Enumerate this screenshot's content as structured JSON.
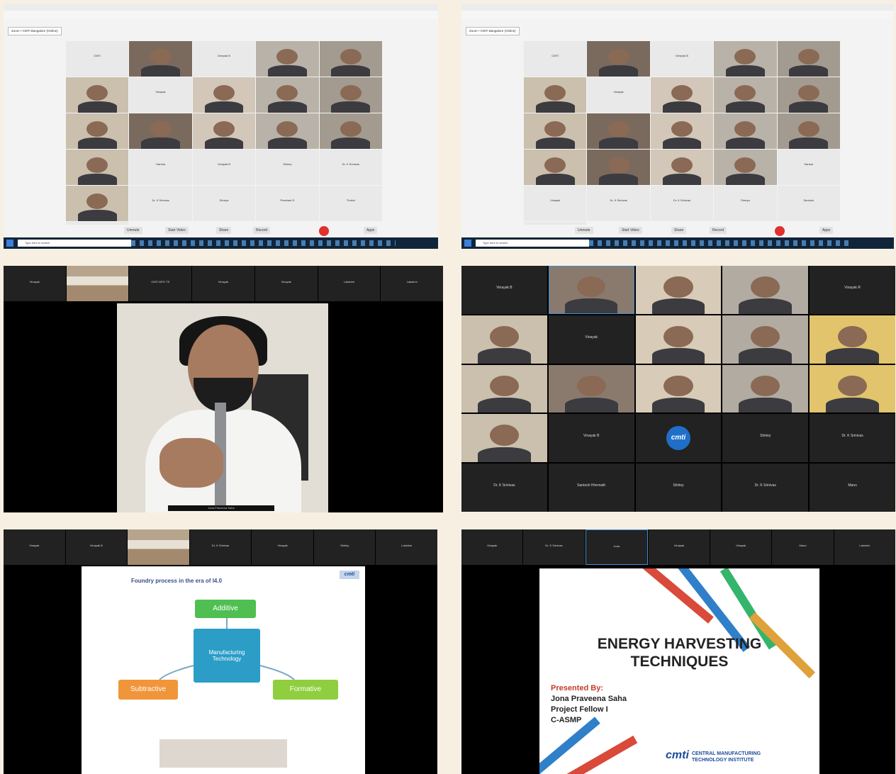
{
  "gallery1": {
    "url_text": "Zoom • CMTI Bangalore (Online)",
    "tiles": [
      "CMTI",
      "",
      "Deepak B",
      "",
      "",
      "",
      "Vinayak",
      "",
      "",
      "",
      "",
      "",
      "",
      "",
      "",
      "",
      "Harsha",
      "Vinayak B",
      "Shirley",
      "Dr. K Srinivas",
      "",
      "Dr. K Srinivas",
      "Shreya",
      "Prashant R",
      "Thrishi",
      "Lakshmi"
    ]
  },
  "gallery2": {
    "url_text": "Zoom • CMTI Bangalore (Online)",
    "tiles": [
      "CMTI",
      "",
      "Deepak B",
      "",
      "",
      "",
      "Vinayak",
      "",
      "",
      "",
      "",
      "",
      "",
      "",
      "",
      "",
      "",
      "",
      "",
      "Sankar",
      "Vinayak",
      "Dr. K Srinivas",
      "Dr. K Srinivas",
      "Shreya",
      "Santosh",
      "Manu"
    ]
  },
  "controls": {
    "unmute": "Unmute",
    "start_video": "Start Video",
    "share": "Share",
    "record": "Record",
    "apps": "Apps",
    "search": "Type here to search"
  },
  "strip3": [
    "Vinayak",
    "",
    "CMTI MFG TE",
    "Vinayak",
    "Vinayak",
    "Lakshmi",
    "Lakshmi"
  ],
  "presenter_caption": "Jona Praveena Saha",
  "grid4": [
    "Vinayak B",
    "",
    "",
    "",
    "Vinayak R",
    "",
    "Vinayak",
    "",
    "",
    "",
    "",
    "",
    "",
    "",
    "",
    "",
    "Vinayak B",
    "CMTI",
    "Shirley",
    "Dr. K Srinivas",
    "Dr. K Srinivas",
    "Santosh Hiremath",
    "Shirley",
    "Dr. K Srinivas",
    "Manu"
  ],
  "strip5": [
    "Vinayak",
    "Vinayak B",
    "",
    "Dr. K Srinivas",
    "Vinayak",
    "Shirley",
    "Lakshmi"
  ],
  "slide5": {
    "title": "Foundry process in the era of I4.0",
    "center": "Manufacturing Technology",
    "top": "Additive",
    "left": "Subtractive",
    "right": "Formative",
    "logo": "cmti"
  },
  "strip6": [
    "Vinayak",
    "Dr. K Srinivas",
    "Jona",
    "Vinayak",
    "Vinayak",
    "Manu",
    "Lakshmi"
  ],
  "slide6": {
    "title1": "ENERGY HARVESTING",
    "title2": "TECHNIQUES",
    "presented_by": "Presented By:",
    "name": "Jona Praveena Saha",
    "role": "Project Fellow I",
    "unit": "C-ASMP",
    "logo": "cmti",
    "institute1": "CENTRAL MANUFACTURING",
    "institute2": "TECHNOLOGY INSTITUTE"
  },
  "colors": {
    "background": "#f7f0e2",
    "additive": "#4fbf52",
    "manufacturing": "#2b9dc7",
    "subtractive": "#f0953a",
    "formative": "#8fce3e",
    "end_meeting": "#e0312f"
  }
}
